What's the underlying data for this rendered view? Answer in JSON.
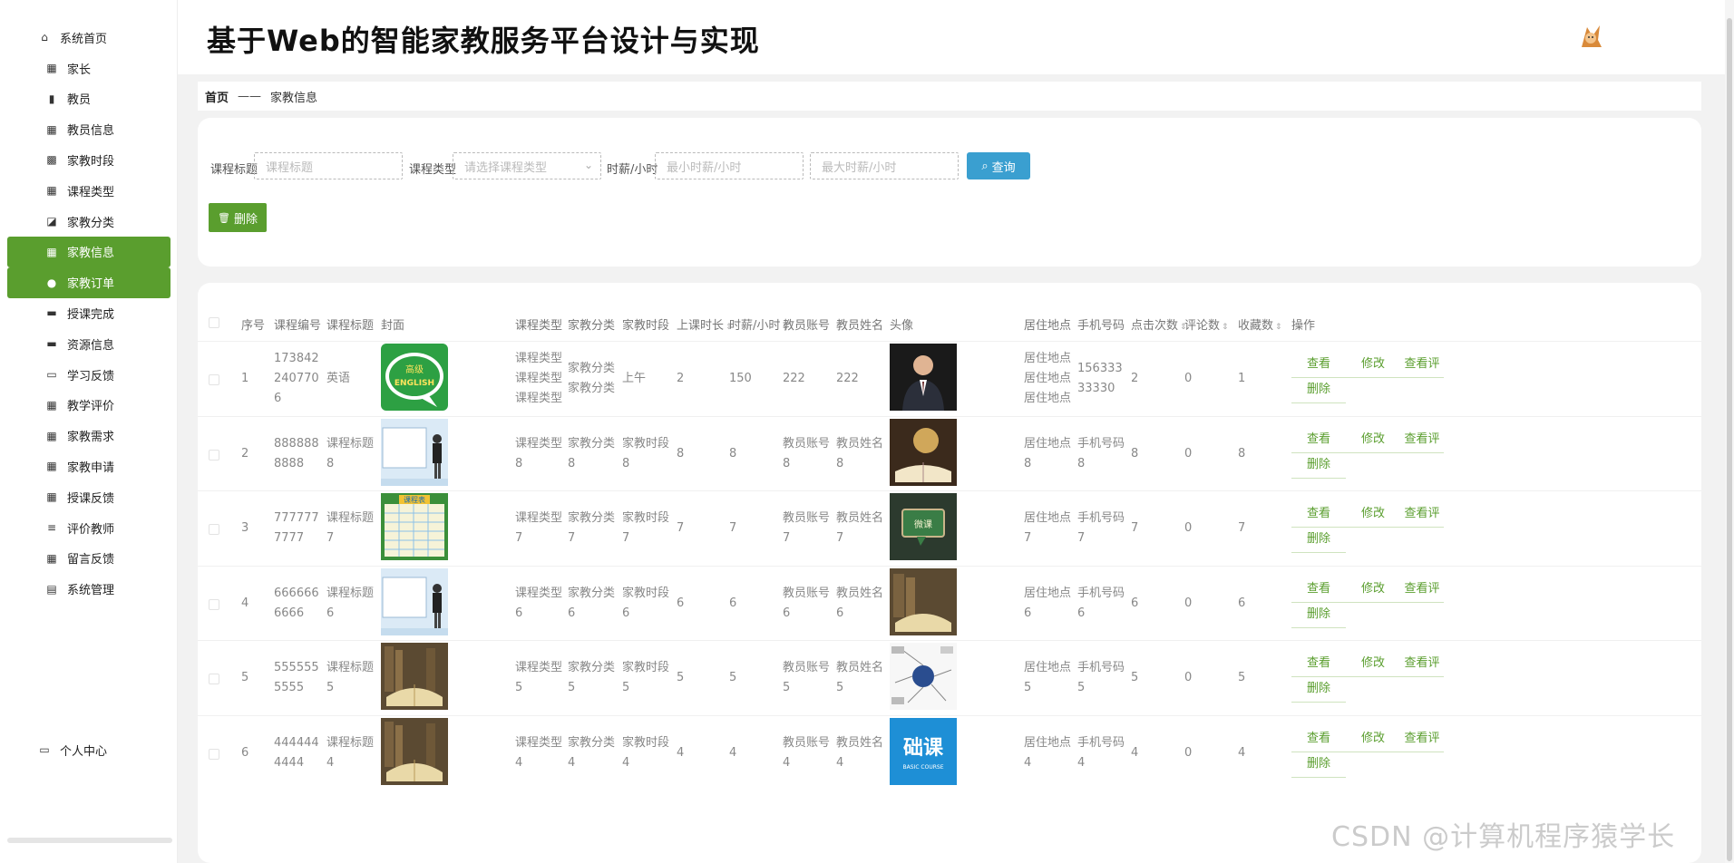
{
  "app_title": "基于Web的智能家教服务平台设计与实现",
  "sidebar": {
    "home": "系统首页",
    "items": [
      {
        "label": "家长",
        "icon": "grid-icon"
      },
      {
        "label": "教员",
        "icon": "bar-chart-icon"
      },
      {
        "label": "教员信息",
        "icon": "grid-icon"
      },
      {
        "label": "家教时段",
        "icon": "apps-icon"
      },
      {
        "label": "课程类型",
        "icon": "grid-icon"
      },
      {
        "label": "家教分类",
        "icon": "tag-icon"
      },
      {
        "label": "家教信息",
        "icon": "grid-icon"
      },
      {
        "label": "家教订单",
        "icon": "user-icon"
      },
      {
        "label": "授课完成",
        "icon": "monitor-icon"
      },
      {
        "label": "资源信息",
        "icon": "monitor-icon"
      },
      {
        "label": "学习反馈",
        "icon": "printer-icon"
      },
      {
        "label": "教学评价",
        "icon": "grid-icon"
      },
      {
        "label": "家教需求",
        "icon": "grid-icon"
      },
      {
        "label": "家教申请",
        "icon": "grid-icon"
      },
      {
        "label": "授课反馈",
        "icon": "grid-icon"
      },
      {
        "label": "评价教师",
        "icon": "sliders-icon"
      },
      {
        "label": "留言反馈",
        "icon": "grid-icon"
      },
      {
        "label": "系统管理",
        "icon": "clipboard-icon"
      }
    ],
    "personal": "个人中心"
  },
  "breadcrumb": {
    "home": "首页",
    "separator": "——",
    "current": "家教信息"
  },
  "search": {
    "title_label": "课程标题",
    "title_placeholder": "课程标题",
    "type_label": "课程类型",
    "type_placeholder": "请选择课程类型",
    "wage_label": "时薪/小时",
    "min_placeholder": "最小时薪/小时",
    "max_placeholder": "最大时薪/小时",
    "query_button": "查询",
    "delete_button": "删除"
  },
  "table": {
    "headers": [
      "序号",
      "课程编号",
      "课程标题",
      "封面",
      "课程类型",
      "家教分类",
      "家教时段",
      "上课时长",
      "时薪/小时",
      "教员账号",
      "教员姓名",
      "头像",
      "居住地点",
      "手机号码",
      "点击次数",
      "评论数",
      "收藏数",
      "操作"
    ],
    "actions": {
      "view": "查看",
      "edit": "修改",
      "review": "查看评",
      "delete": "删除"
    },
    "rows": [
      {
        "no": "1",
        "code": "1738422407706",
        "title": "英语",
        "type": "课程类型课程类型课程类型",
        "cat": "家教分类家教分类",
        "slot": "上午",
        "dur": "2",
        "wage": "150",
        "acct": "222",
        "name": "222",
        "addr": "居住地点居住地点居住地点",
        "phone": "15633333330",
        "clicks": "2",
        "comments": "0",
        "favs": "1",
        "cover_text_1": "高级",
        "cover_text_2": "ENGLISH"
      },
      {
        "no": "2",
        "code": "8888888888",
        "title": "课程标题8",
        "type": "课程类型8",
        "cat": "家教分类8",
        "slot": "家教时段8",
        "dur": "8",
        "wage": "8",
        "acct": "教员账号8",
        "name": "教员姓名8",
        "addr": "居住地点8",
        "phone": "手机号码8",
        "clicks": "8",
        "comments": "0",
        "favs": "8"
      },
      {
        "no": "3",
        "code": "7777777777",
        "title": "课程标题7",
        "type": "课程类型7",
        "cat": "家教分类7",
        "slot": "家教时段7",
        "dur": "7",
        "wage": "7",
        "acct": "教员账号7",
        "name": "教员姓名7",
        "addr": "居住地点7",
        "phone": "手机号码7",
        "clicks": "7",
        "comments": "0",
        "favs": "7",
        "cover_text_1": "课程表",
        "avatar_text": "微课"
      },
      {
        "no": "4",
        "code": "6666666666",
        "title": "课程标题6",
        "type": "课程类型6",
        "cat": "家教分类6",
        "slot": "家教时段6",
        "dur": "6",
        "wage": "6",
        "acct": "教员账号6",
        "name": "教员姓名6",
        "addr": "居住地点6",
        "phone": "手机号码6",
        "clicks": "6",
        "comments": "0",
        "favs": "6"
      },
      {
        "no": "5",
        "code": "5555555555",
        "title": "课程标题5",
        "type": "课程类型5",
        "cat": "家教分类5",
        "slot": "家教时段5",
        "dur": "5",
        "wage": "5",
        "acct": "教员账号5",
        "name": "教员姓名5",
        "addr": "居住地点5",
        "phone": "手机号码5",
        "clicks": "5",
        "comments": "0",
        "favs": "5"
      },
      {
        "no": "6",
        "code": "4444444444",
        "title": "课程标题4",
        "type": "课程类型4",
        "cat": "家教分类4",
        "slot": "家教时段4",
        "dur": "4",
        "wage": "4",
        "acct": "教员账号4",
        "name": "教员姓名4",
        "addr": "居住地点4",
        "phone": "手机号码4",
        "clicks": "4",
        "comments": "0",
        "favs": "4",
        "avatar_text": "础课",
        "avatar_sub": "BASIC COURSE"
      }
    ]
  },
  "watermark": "CSDN @计算机程序猿学长",
  "colors": {
    "primary": "#5a9e2e",
    "query": "#3a9fd0"
  }
}
